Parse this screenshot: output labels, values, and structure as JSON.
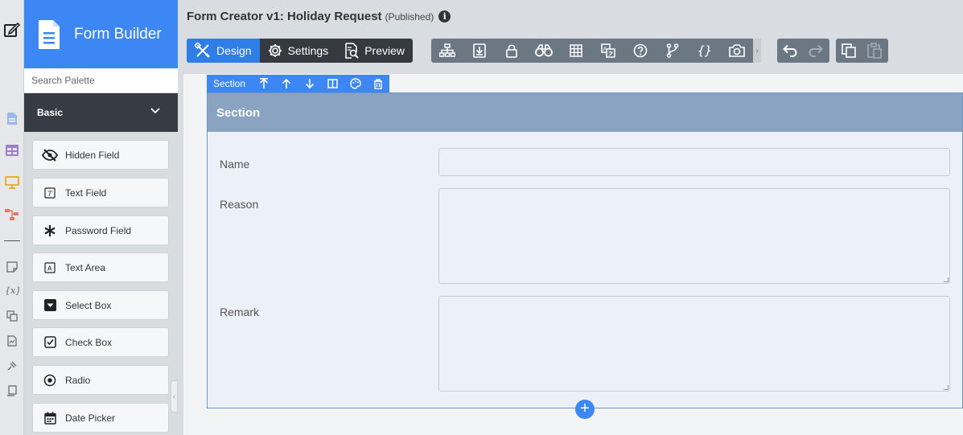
{
  "app": {
    "brand_title": "Form Builder",
    "form_title": "Form Creator v1: Holiday Request",
    "form_status": "(Published)",
    "info_glyph": "i"
  },
  "palette": {
    "search_placeholder": "Search Palette",
    "category": "Basic",
    "items": [
      {
        "label": "Hidden Field",
        "icon": "eye-slash-icon"
      },
      {
        "label": "Text Field",
        "icon": "text-field-icon"
      },
      {
        "label": "Password Field",
        "icon": "asterisk-icon"
      },
      {
        "label": "Text Area",
        "icon": "text-area-icon"
      },
      {
        "label": "Select Box",
        "icon": "select-box-icon"
      },
      {
        "label": "Check Box",
        "icon": "checkbox-icon"
      },
      {
        "label": "Radio",
        "icon": "radio-icon"
      },
      {
        "label": "Date Picker",
        "icon": "calendar-icon"
      }
    ]
  },
  "modes": [
    {
      "label": "Design",
      "icon": "design-tools-icon",
      "active": true
    },
    {
      "label": "Settings",
      "icon": "gear-icon",
      "active": false
    },
    {
      "label": "Preview",
      "icon": "preview-icon",
      "active": false
    }
  ],
  "toolbar_icons": [
    "sitemap-icon",
    "import-icon",
    "lock-icon",
    "binoculars-icon",
    "grid-icon",
    "translate-icon",
    "help-icon",
    "branch-icon",
    "json-braces-icon",
    "camera-icon"
  ],
  "section": {
    "toolbar_label": "Section",
    "title": "Section",
    "fields": [
      {
        "label": "Name",
        "type": "text",
        "value": ""
      },
      {
        "label": "Reason",
        "type": "textarea",
        "value": ""
      },
      {
        "label": "Remark",
        "type": "textarea",
        "value": ""
      }
    ],
    "add_glyph": "+"
  },
  "colors": {
    "accent": "#3d87f5",
    "dark": "#343a40",
    "toolbar": "#6b7884",
    "section_header": "#89a3c0"
  }
}
